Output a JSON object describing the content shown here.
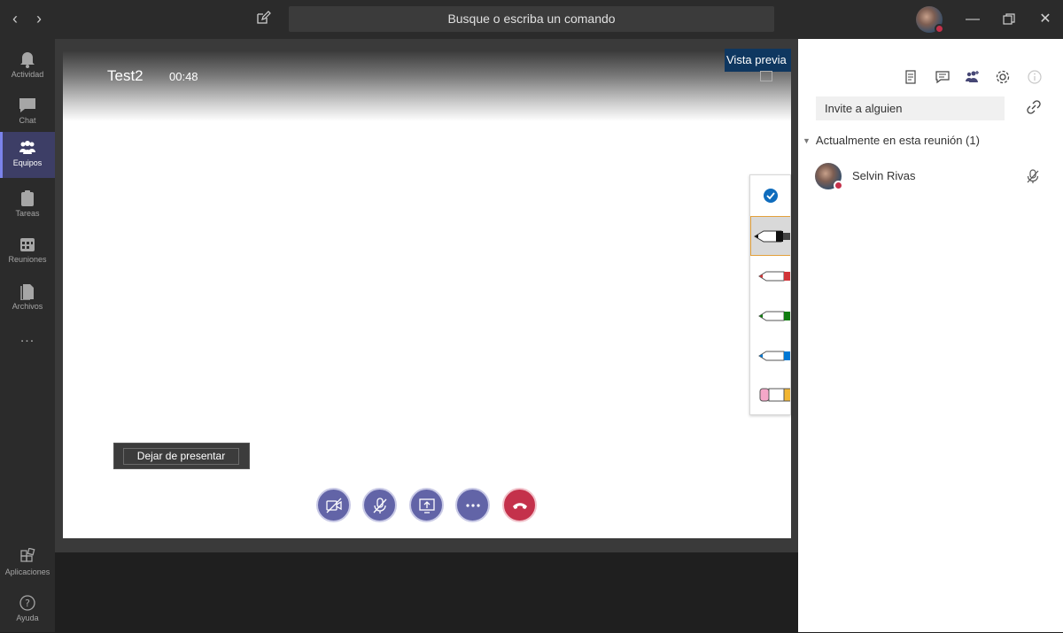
{
  "titlebar": {
    "search_placeholder": "Busque o escriba un comando"
  },
  "rail": {
    "items": [
      {
        "label": "Actividad",
        "icon": "bell-icon"
      },
      {
        "label": "Chat",
        "icon": "chat-icon"
      },
      {
        "label": "Equipos",
        "icon": "teams-icon",
        "active": true
      },
      {
        "label": "Tareas",
        "icon": "tasks-icon"
      },
      {
        "label": "Reuniones",
        "icon": "calendar-icon"
      },
      {
        "label": "Archivos",
        "icon": "files-icon"
      },
      {
        "label": "...",
        "icon": "more-icon"
      }
    ],
    "bottom": [
      {
        "label": "Aplicaciones",
        "icon": "apps-icon"
      },
      {
        "label": "Ayuda",
        "icon": "help-icon"
      }
    ]
  },
  "meeting": {
    "title": "Test2",
    "elapsed": "00:48",
    "preview_label": "Vista previa",
    "stop_presenting": "Dejar de presentar"
  },
  "pens": [
    {
      "name": "select",
      "color": "#0f6cbd"
    },
    {
      "name": "black-pen",
      "color": "#222222",
      "selected": true
    },
    {
      "name": "red-pen",
      "color": "#d13438"
    },
    {
      "name": "green-pen",
      "color": "#107c10"
    },
    {
      "name": "blue-pen",
      "color": "#0078d4"
    },
    {
      "name": "eraser",
      "color": "#f4a7c8"
    }
  ],
  "call_controls": [
    "camera-off-icon",
    "mic-off-icon",
    "share-screen-icon",
    "more-options-icon",
    "hang-up-icon"
  ],
  "panel": {
    "invite_placeholder": "Invite a alguien",
    "section_title": "Actualmente en esta reunión (1)",
    "participants": [
      {
        "name": "Selvin Rivas",
        "muted": true
      }
    ]
  },
  "colors": {
    "accent": "#6264a7",
    "hangup": "#c4314b",
    "status_busy": "#c4314b"
  }
}
